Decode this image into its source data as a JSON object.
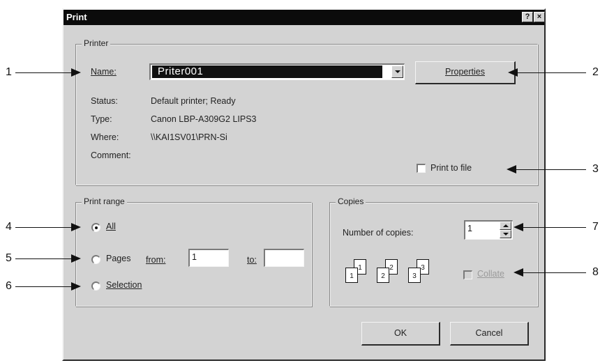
{
  "dialog": {
    "title": "Print",
    "help_button": "?",
    "close_button": "×"
  },
  "printer": {
    "legend": "Printer",
    "name_label": "Name:",
    "name_value": "Priter001",
    "properties_button": "Properties",
    "status_label": "Status:",
    "status_value": "Default printer; Ready",
    "type_label": "Type:",
    "type_value": "Canon LBP-A309G2 LIPS3",
    "where_label": "Where:",
    "where_value": "\\\\KAI1SV01\\PRN-Si",
    "comment_label": "Comment:",
    "comment_value": "",
    "print_to_file_label": "Print to file",
    "print_to_file_checked": false
  },
  "print_range": {
    "legend": "Print range",
    "all_label": "All",
    "pages_label": "Pages",
    "from_label": "from:",
    "from_value": "1",
    "to_label": "to:",
    "to_value": "",
    "selection_label": "Selection",
    "selected": "all"
  },
  "copies": {
    "legend": "Copies",
    "number_label": "Number of copies:",
    "number_value": "1",
    "collate_label": "Collate",
    "collate_enabled": false,
    "collate_icons": [
      {
        "back": "1",
        "front": "1"
      },
      {
        "back": "2",
        "front": "2"
      },
      {
        "back": "3",
        "front": "3"
      }
    ]
  },
  "buttons": {
    "ok": "OK",
    "cancel": "Cancel"
  },
  "callouts": [
    "1",
    "2",
    "3",
    "4",
    "5",
    "6",
    "7",
    "8"
  ]
}
